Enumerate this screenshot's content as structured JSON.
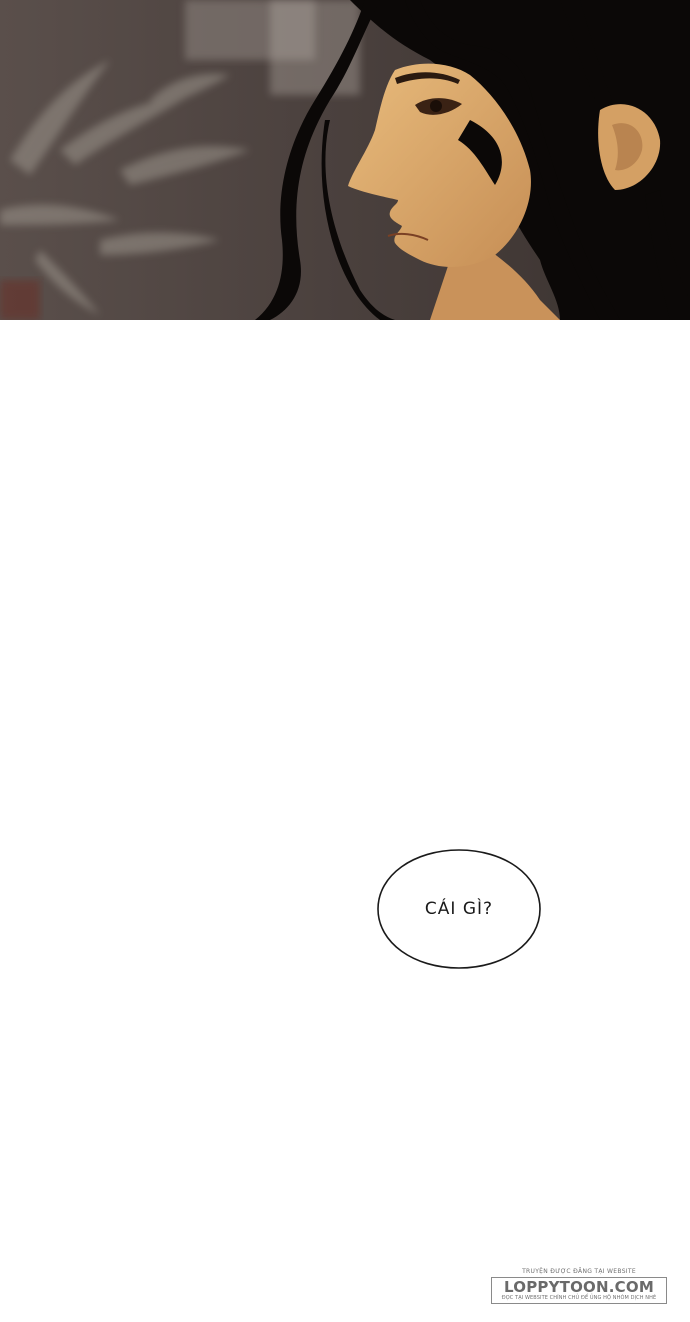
{
  "panel": {
    "illustration_icon": "illustration-character-profile",
    "colors": {
      "background": "#4a403d",
      "hair": "#0b0807",
      "skin": "#d9a969",
      "skin_shadow": "#b98450"
    }
  },
  "speech_bubble": {
    "text": "CÁI GÌ?"
  },
  "watermark": {
    "tagline": "TRUYỆN ĐƯỢC ĐĂNG TẠI WEBSITE",
    "brand": "LOPPYTOON.COM",
    "note": "ĐỌC TẠI WEBSITE CHÍNH CHỦ ĐỂ ỦNG HỘ NHÓM DỊCH NHÉ"
  }
}
